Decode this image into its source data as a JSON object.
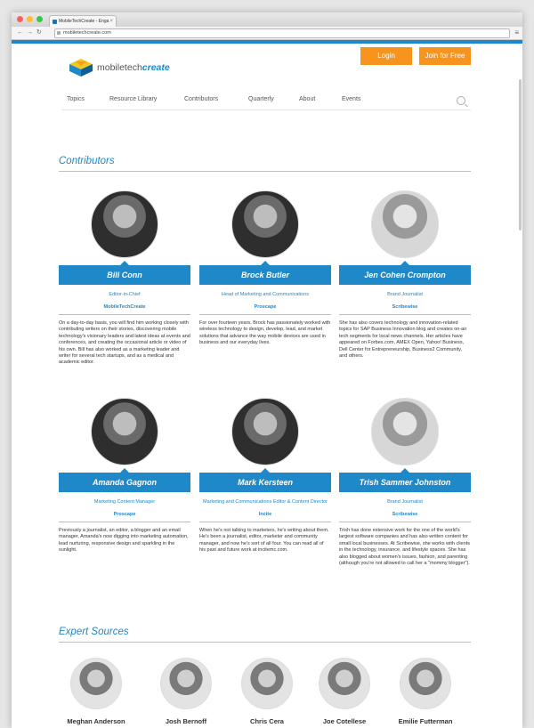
{
  "browser": {
    "tab_title": "MobileTechCreate - Enga",
    "url": "mobiletechcreate.com"
  },
  "header": {
    "logo_text_plain": "mobiletech",
    "logo_text_accent": "create",
    "login_label": "Login",
    "join_label": "Join for Free"
  },
  "nav": {
    "items": [
      "Topics",
      "Resource Library",
      "Contributors",
      "Quarterly",
      "About",
      "Events"
    ]
  },
  "contributors_title": "Contributors",
  "contributors": [
    {
      "name": "Bill Conn",
      "role": "Editor-in-Chief",
      "company": "MobileTechCreate",
      "bio": "On a day-to-day basis, you will find him working closely with contributing writers on their stories, discovering mobile technology's visionary leaders and latest ideas at events and conferences, and creating the occasional article or video of his own. Bill has also worked as a marketing leader and writer for several tech startups, and as a medical and academic editor."
    },
    {
      "name": "Brock Butler",
      "role": "Head of Marketing and Communications",
      "company": "Proscape",
      "bio": "For over fourteen years, Brock has passionately worked with wireless technology to design, develop, lead, and market solutions that advance the way mobile devices are used in business and our everyday lives."
    },
    {
      "name": "Jen Cohen Crompton",
      "role": "Brand Journalist",
      "company": "Scribewise",
      "bio": "She has also covers technology and innovation-related topics for SAP Business Innovation blog and creates on-air tech segments for local news channels. Her articles have appeared on Forbes.com, AMEX Open, Yahoo! Business, Dell Center for Entrepreneurship, Business2 Community, and others."
    },
    {
      "name": "Amanda Gagnon",
      "role": "Marketing Content Manager",
      "company": "Proscape",
      "bio": "Previously a journalist, an editor, a blogger and an email manager, Amanda's now digging into marketing automation, lead nurturing, responsive design and sparkling in the sunlight."
    },
    {
      "name": "Mark Kersteen",
      "role": "Marketing and Communications Editor & Content Director",
      "company": "Incite",
      "bio": "When he's not talking to marketers, he's writing about them. He's been a journalist, editor, marketer and community manager, and now he's sort of all four. You can read all of his past and future work at incitemc.com."
    },
    {
      "name": "Trish Sammer Johnston",
      "role": "Brand Journalist",
      "company": "Scribewise",
      "bio": "Trish has done extensive work for the one of the world's largest software companies and has also written content for small local businesses. At Scribewise, she works with clients in the technology, insurance, and lifestyle spaces. She has also blogged about women's issues, fashion, and parenting (although you're not allowed to call her a \"mommy blogger\")."
    }
  ],
  "experts_title": "Expert Sources",
  "experts": [
    {
      "name": "Meghan Anderson"
    },
    {
      "name": "Josh Bernoff"
    },
    {
      "name": "Chris Cera"
    },
    {
      "name": "Joe Cotellese"
    },
    {
      "name": "Emilie Futterman"
    }
  ],
  "colors": {
    "accent": "#1e88c9",
    "button": "#f7941d"
  }
}
